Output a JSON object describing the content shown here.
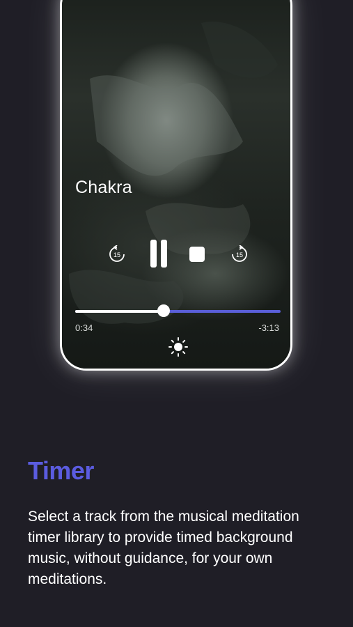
{
  "player": {
    "track_title": "Chakra",
    "elapsed": "0:34",
    "remaining": "-3:13",
    "progress_fraction": 0.43,
    "skip_seconds": "15",
    "accent_color": "#5a5fd8"
  },
  "feature": {
    "heading": "Timer",
    "description": "Select a track from the musical meditation timer library to provide timed background music, without guidance, for your own meditations.",
    "heading_color": "#5b5ce0"
  }
}
